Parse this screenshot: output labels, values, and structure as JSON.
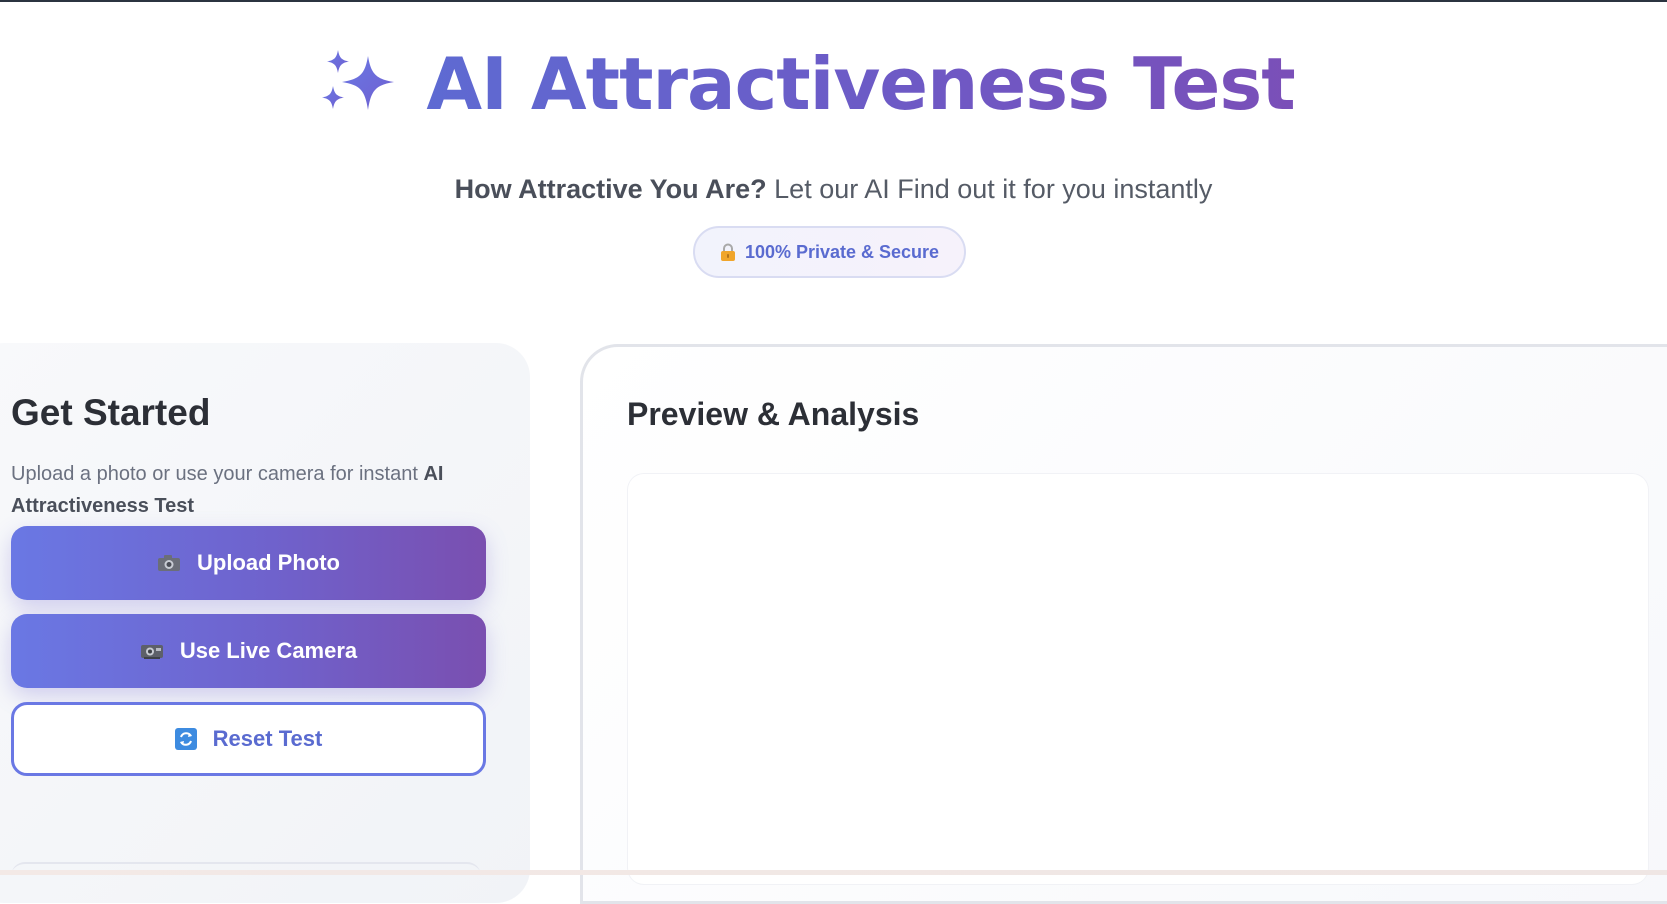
{
  "header": {
    "icon": "sparkles-icon",
    "title": "AI Attractiveness Test",
    "subtitle_bold": "How Attractive You Are?",
    "subtitle_rest": " Let our AI Find out it for you instantly",
    "badge_icon": "lock-icon",
    "badge_text": "100% Private & Secure"
  },
  "left": {
    "heading": "Get Started",
    "desc_plain": "Upload a photo or use your camera for instant ",
    "desc_bold": "AI Attractiveness Test",
    "buttons": [
      {
        "label": "Upload Photo",
        "icon": "camera-icon"
      },
      {
        "label": "Use Live Camera",
        "icon": "video-camera-icon"
      },
      {
        "label": "Reset Test",
        "icon": "refresh-icon"
      }
    ]
  },
  "right": {
    "heading": "Preview & Analysis"
  },
  "colors": {
    "accent": "#6a78e4",
    "accent_end": "#7a4fb0",
    "badge_text": "#5a6bd0"
  }
}
